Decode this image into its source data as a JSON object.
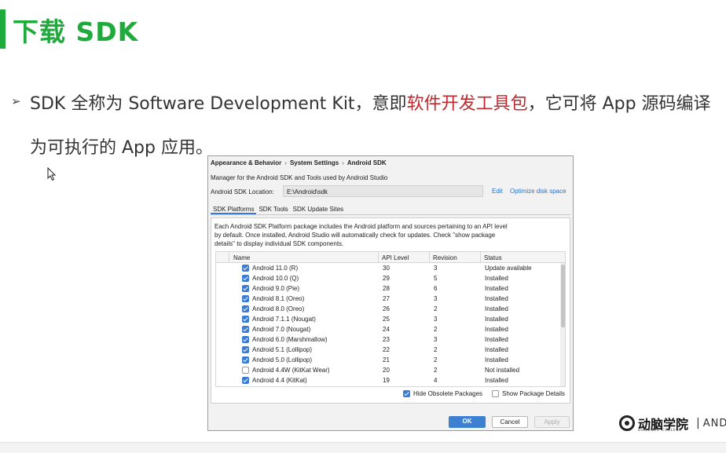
{
  "slide": {
    "title": "下载 SDK",
    "bullet_part1": "SDK 全称为 Software Development Kit，意即",
    "bullet_highlight": "软件开发工具包",
    "bullet_part2": "，它可将 App 源码编译",
    "bullet_line2": "为可执行的 App 应用。",
    "highlight_color": "#c0282d",
    "accent_color": "#1faa3c"
  },
  "dialog": {
    "breadcrumbs": [
      "Appearance & Behavior",
      "System Settings",
      "Android SDK"
    ],
    "description": "Manager for the Android SDK and Tools used by Android Studio",
    "location_label": "Android SDK Location:",
    "location_value": "E:\\Android\\sdk",
    "edit_link": "Edit",
    "optimize_link": "Optimize disk space",
    "tabs": [
      "SDK Platforms",
      "SDK Tools",
      "SDK Update Sites"
    ],
    "panel_description": "Each Android SDK Platform package includes the Android platform and sources pertaining to an API level by default. Once installed, Android Studio will automatically check for updates. Check \"show package details\" to display individual SDK components.",
    "columns": [
      "Name",
      "API Level",
      "Revision",
      "Status"
    ],
    "rows": [
      {
        "name": "Android 11.0 (R)",
        "api": "30",
        "rev": "3",
        "status": "Update available",
        "checked": true
      },
      {
        "name": "Android 10.0 (Q)",
        "api": "29",
        "rev": "5",
        "status": "Installed",
        "checked": true
      },
      {
        "name": "Android 9.0 (Pie)",
        "api": "28",
        "rev": "6",
        "status": "Installed",
        "checked": true
      },
      {
        "name": "Android 8.1 (Oreo)",
        "api": "27",
        "rev": "3",
        "status": "Installed",
        "checked": true
      },
      {
        "name": "Android 8.0 (Oreo)",
        "api": "26",
        "rev": "2",
        "status": "Installed",
        "checked": true
      },
      {
        "name": "Android 7.1.1 (Nougat)",
        "api": "25",
        "rev": "3",
        "status": "Installed",
        "checked": true
      },
      {
        "name": "Android 7.0 (Nougat)",
        "api": "24",
        "rev": "2",
        "status": "Installed",
        "checked": true
      },
      {
        "name": "Android 6.0 (Marshmallow)",
        "api": "23",
        "rev": "3",
        "status": "Installed",
        "checked": true
      },
      {
        "name": "Android 5.1 (Lollipop)",
        "api": "22",
        "rev": "2",
        "status": "Installed",
        "checked": true
      },
      {
        "name": "Android 5.0 (Lollipop)",
        "api": "21",
        "rev": "2",
        "status": "Installed",
        "checked": true
      },
      {
        "name": "Android 4.4W (KitKat Wear)",
        "api": "20",
        "rev": "2",
        "status": "Not installed",
        "checked": false
      },
      {
        "name": "Android 4.4 (KitKat)",
        "api": "19",
        "rev": "4",
        "status": "Installed",
        "checked": true
      }
    ],
    "hide_obsolete_label": "Hide Obsolete Packages",
    "hide_obsolete_checked": true,
    "show_details_label": "Show Package Details",
    "show_details_checked": false,
    "ok_label": "OK",
    "cancel_label": "Cancel",
    "apply_label": "Apply"
  },
  "brand": {
    "name": "动脑学院",
    "sub": "DONGNAO COLLEGE",
    "separator": "|",
    "english": "ANDRO"
  }
}
